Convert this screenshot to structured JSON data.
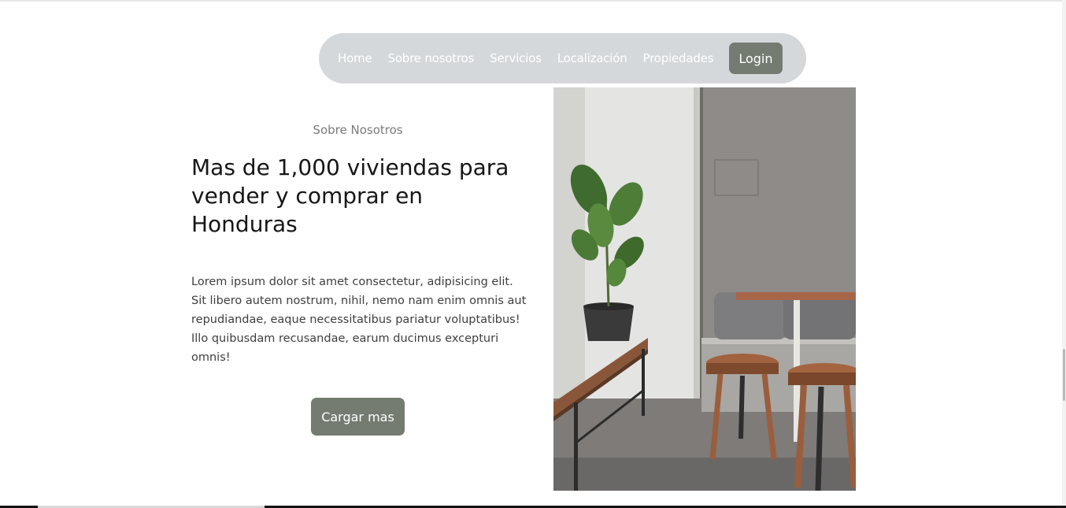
{
  "nav": {
    "links": [
      "Home",
      "Sobre nosotros",
      "Servicios",
      "Localización",
      "Propiedades"
    ],
    "login_label": "Login"
  },
  "about": {
    "eyebrow": "Sobre Nosotros",
    "headline": "Mas de 1,000 viviendas para vender y comprar en Honduras",
    "body": "Lorem ipsum dolor sit amet consectetur, adipisicing elit. Sit libero autem nostrum, nihil, nemo nam enim omnis aut repudiandae, eaque necessitatibus pariatur voluptatibus! Illo quibusdam recusandae, earum ducimus excepturi omnis!",
    "cta_label": "Cargar mas"
  },
  "colors": {
    "accent": "#747c72",
    "nav_background": "#d5d8db",
    "text_dark": "#161616",
    "text_muted": "#7a7a7a"
  }
}
